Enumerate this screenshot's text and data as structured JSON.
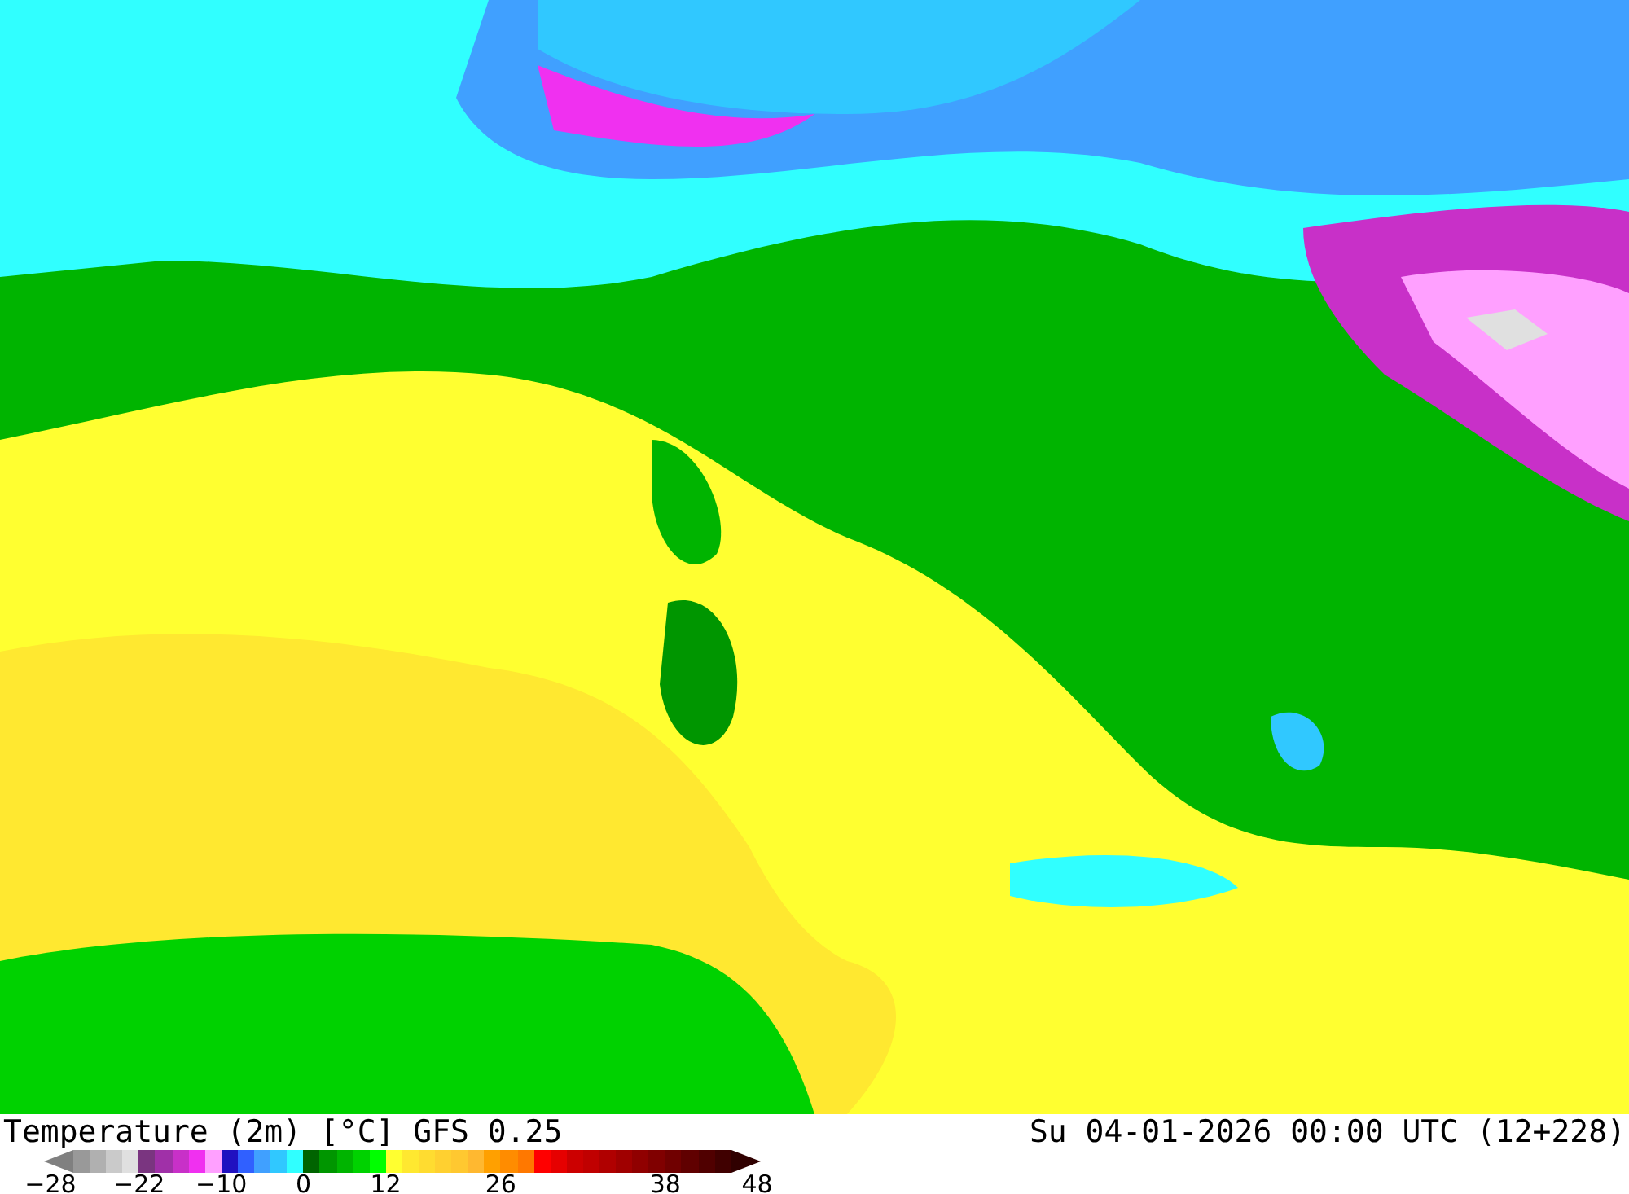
{
  "map": {
    "title": "Temperature (2m) [°C] GFS 0.25",
    "valid_time": "Su 04-01-2026 00:00 UTC (12+228)"
  },
  "legend": {
    "min_arrow": {
      "color": "#808080",
      "label": "−28"
    },
    "max_arrow": {
      "color": "#300000",
      "label": "48"
    },
    "swatches": [
      {
        "color": "#999999"
      },
      {
        "color": "#b0b0b0"
      },
      {
        "color": "#cacaca"
      },
      {
        "color": "#e0e0e0"
      },
      {
        "color": "#7a3580",
        "label": "−22"
      },
      {
        "color": "#a030a8"
      },
      {
        "color": "#c830c8"
      },
      {
        "color": "#f030f0"
      },
      {
        "color": "#ffa0ff"
      },
      {
        "color": "#2010c0",
        "label": "−10"
      },
      {
        "color": "#3060ff"
      },
      {
        "color": "#40a0ff"
      },
      {
        "color": "#30c8ff"
      },
      {
        "color": "#30ffff"
      },
      {
        "color": "#006400",
        "label": "0"
      },
      {
        "color": "#009600"
      },
      {
        "color": "#00b400"
      },
      {
        "color": "#00d200"
      },
      {
        "color": "#00ff00"
      },
      {
        "color": "#ffff30",
        "label": "12"
      },
      {
        "color": "#ffe830"
      },
      {
        "color": "#ffdc30"
      },
      {
        "color": "#ffd030"
      },
      {
        "color": "#ffc830"
      },
      {
        "color": "#ffb830"
      },
      {
        "color": "#ffa000"
      },
      {
        "color": "#ff8c00",
        "label": "26"
      },
      {
        "color": "#ff7800"
      },
      {
        "color": "#ff0000"
      },
      {
        "color": "#e60000"
      },
      {
        "color": "#cc0000"
      },
      {
        "color": "#c00000"
      },
      {
        "color": "#b00000"
      },
      {
        "color": "#a00000"
      },
      {
        "color": "#900000"
      },
      {
        "color": "#800000"
      },
      {
        "color": "#700000",
        "label": "38"
      },
      {
        "color": "#600000"
      },
      {
        "color": "#500000"
      },
      {
        "color": "#400000"
      }
    ]
  }
}
